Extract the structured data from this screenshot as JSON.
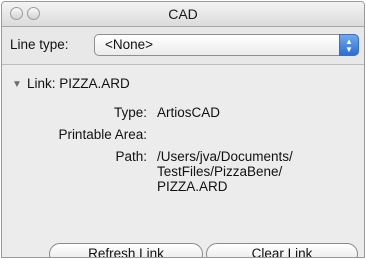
{
  "window": {
    "title": "CAD"
  },
  "line_type": {
    "label": "Line type:",
    "selected": "<None>"
  },
  "link": {
    "label": "Link: PIZZA.ARD",
    "type_label": "Type:",
    "type_value": "ArtiosCAD",
    "printable_area_label": "Printable Area:",
    "printable_area_value": "",
    "path_label": "Path:",
    "path_value": "/Users/jva/Documents/\nTestFiles/PizzaBene/\nPIZZA.ARD"
  },
  "buttons": {
    "refresh": "Refresh Link",
    "clear": "Clear Link"
  },
  "icons": {
    "close": "close-button-icon",
    "minimize": "minimize-button-icon",
    "disclosure": "disclosure-triangle-down-icon",
    "popup": "popup-arrows-icon"
  }
}
